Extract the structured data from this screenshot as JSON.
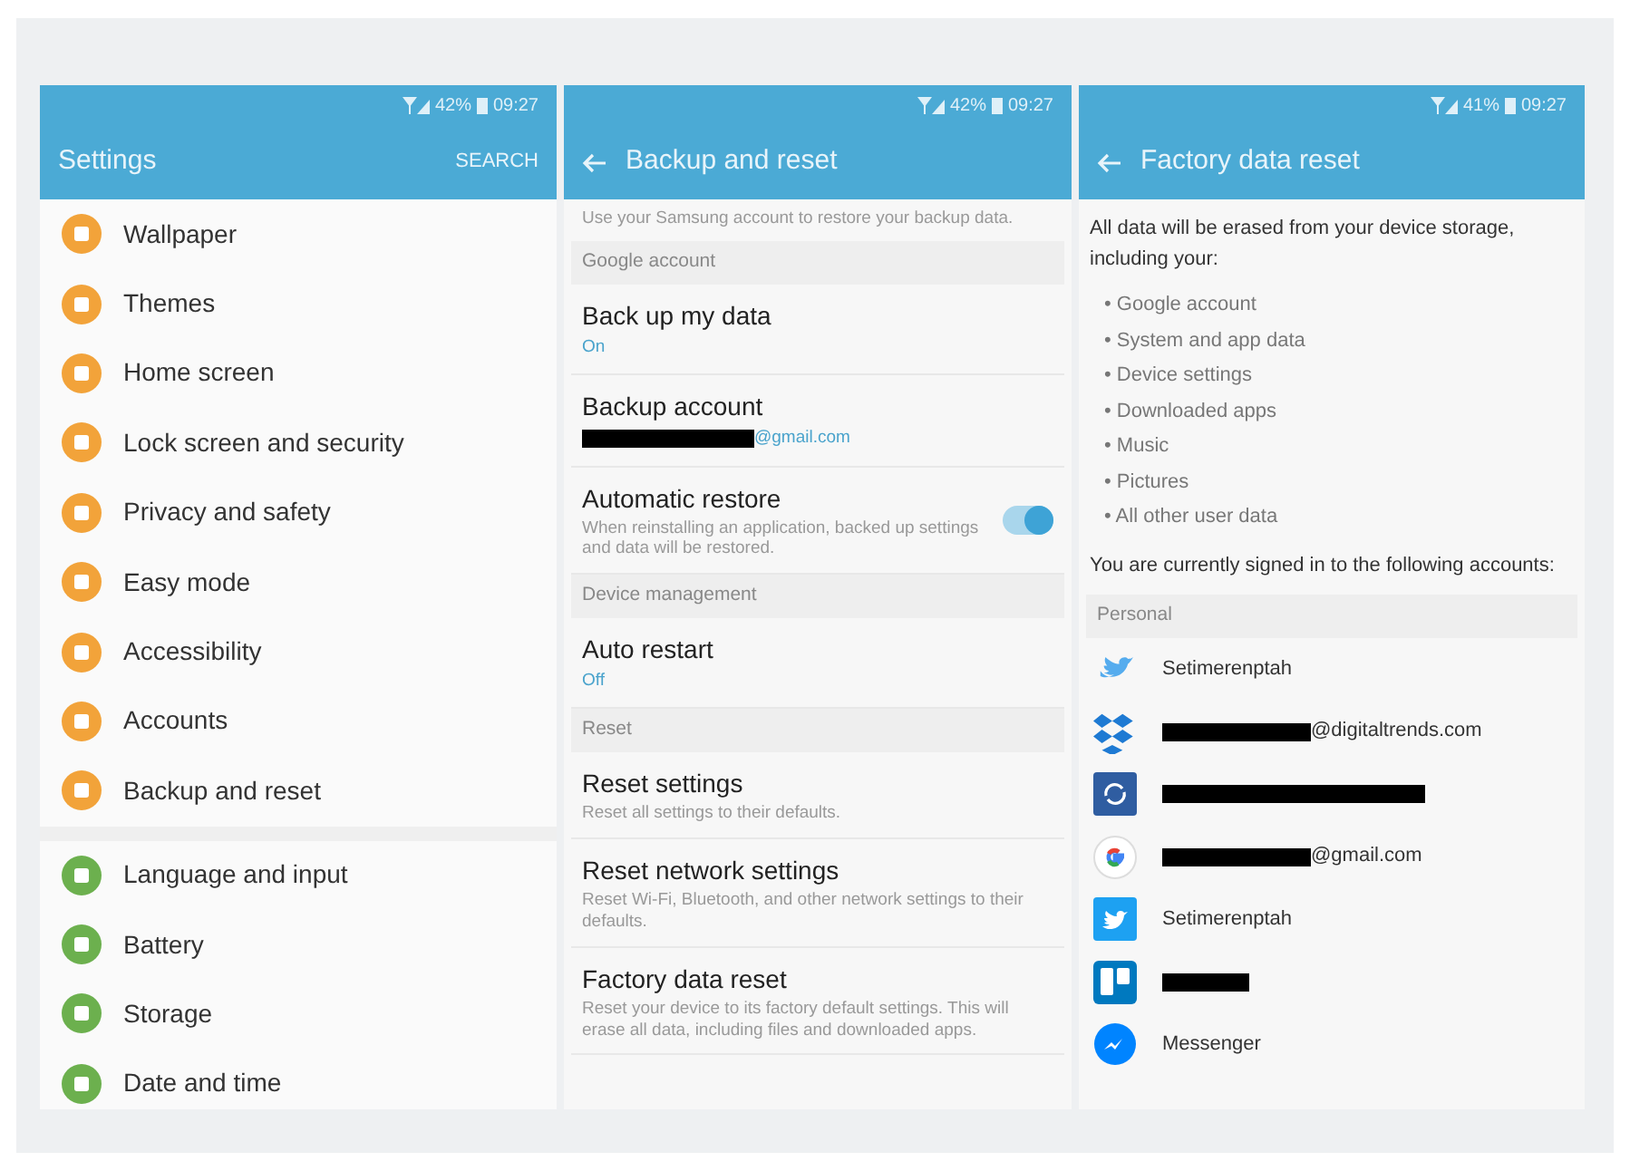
{
  "panels": [
    {
      "kind": "settings",
      "status": {
        "battery": "42%",
        "time": "09:27"
      },
      "title": "Settings",
      "action": "SEARCH",
      "groups": [
        {
          "items": [
            {
              "label": "Wallpaper",
              "color": "#f2a33a"
            },
            {
              "label": "Themes",
              "color": "#f2a33a"
            },
            {
              "label": "Home screen",
              "color": "#f2a33a"
            },
            {
              "label": "Lock screen and security",
              "color": "#f2a33a"
            },
            {
              "label": "Privacy and safety",
              "color": "#f2a33a"
            },
            {
              "label": "Easy mode",
              "color": "#f2a33a"
            },
            {
              "label": "Accessibility",
              "color": "#f2a33a"
            },
            {
              "label": "Accounts",
              "color": "#f2a33a"
            },
            {
              "label": "Backup and reset",
              "color": "#f2a33a"
            }
          ]
        },
        {
          "items": [
            {
              "label": "Language and input",
              "color": "#6cb04e"
            },
            {
              "label": "Battery",
              "color": "#6cb04e"
            },
            {
              "label": "Storage",
              "color": "#6cb04e"
            },
            {
              "label": "Date and time",
              "color": "#6cb04e"
            }
          ]
        }
      ]
    },
    {
      "kind": "backup",
      "status": {
        "battery": "42%",
        "time": "09:27"
      },
      "title": "Backup and reset",
      "rows": [
        {
          "kind": "note",
          "text": "Use your Samsung account to restore your backup data."
        },
        {
          "kind": "section",
          "text": "Google account"
        },
        {
          "kind": "value",
          "title": "Back up my data",
          "value": "On"
        },
        {
          "kind": "value",
          "title": "Backup account",
          "value": "@gmail.com",
          "redacted": true
        },
        {
          "kind": "toggle",
          "title": "Automatic restore",
          "text": "When reinstalling an application, backed up settings and data will be restored.",
          "on": true
        },
        {
          "kind": "section",
          "text": "Device management"
        },
        {
          "kind": "value",
          "title": "Auto restart",
          "value": "Off"
        },
        {
          "kind": "section",
          "text": "Reset"
        },
        {
          "kind": "item",
          "title": "Reset settings",
          "text": "Reset all settings to their defaults."
        },
        {
          "kind": "item",
          "title": "Reset network settings",
          "text": "Reset Wi-Fi, Bluetooth, and other network settings to their defaults."
        },
        {
          "kind": "item",
          "title": "Factory data reset",
          "text": "Reset your device to its factory default settings. This will erase all data, including files and downloaded apps."
        }
      ]
    },
    {
      "kind": "factory",
      "status": {
        "battery": "41%",
        "time": "09:27"
      },
      "title": "Factory data reset",
      "intro": "All data will be erased from your device storage, including your:",
      "bullets": [
        "• Google account",
        "• System and app data",
        "• Device settings",
        "• Downloaded apps",
        "• Music",
        "• Pictures",
        "• All other user data"
      ],
      "signed_in": "You are currently signed in to the following accounts:",
      "section": "Personal",
      "accounts": [
        {
          "kind": "twitter",
          "text": "Setimerenptah",
          "redacted": false
        },
        {
          "kind": "dropbox",
          "text": "@digitaltrends.com",
          "redacted": true
        },
        {
          "kind": "sync",
          "redacted": true
        },
        {
          "kind": "google",
          "text": "@gmail.com",
          "redacted": true
        },
        {
          "kind": "twitter-square",
          "text": "Setimerenptah",
          "redacted": false
        },
        {
          "kind": "trello",
          "redacted": true
        },
        {
          "kind": "messenger",
          "text": "Messenger",
          "redacted": false
        }
      ]
    }
  ]
}
